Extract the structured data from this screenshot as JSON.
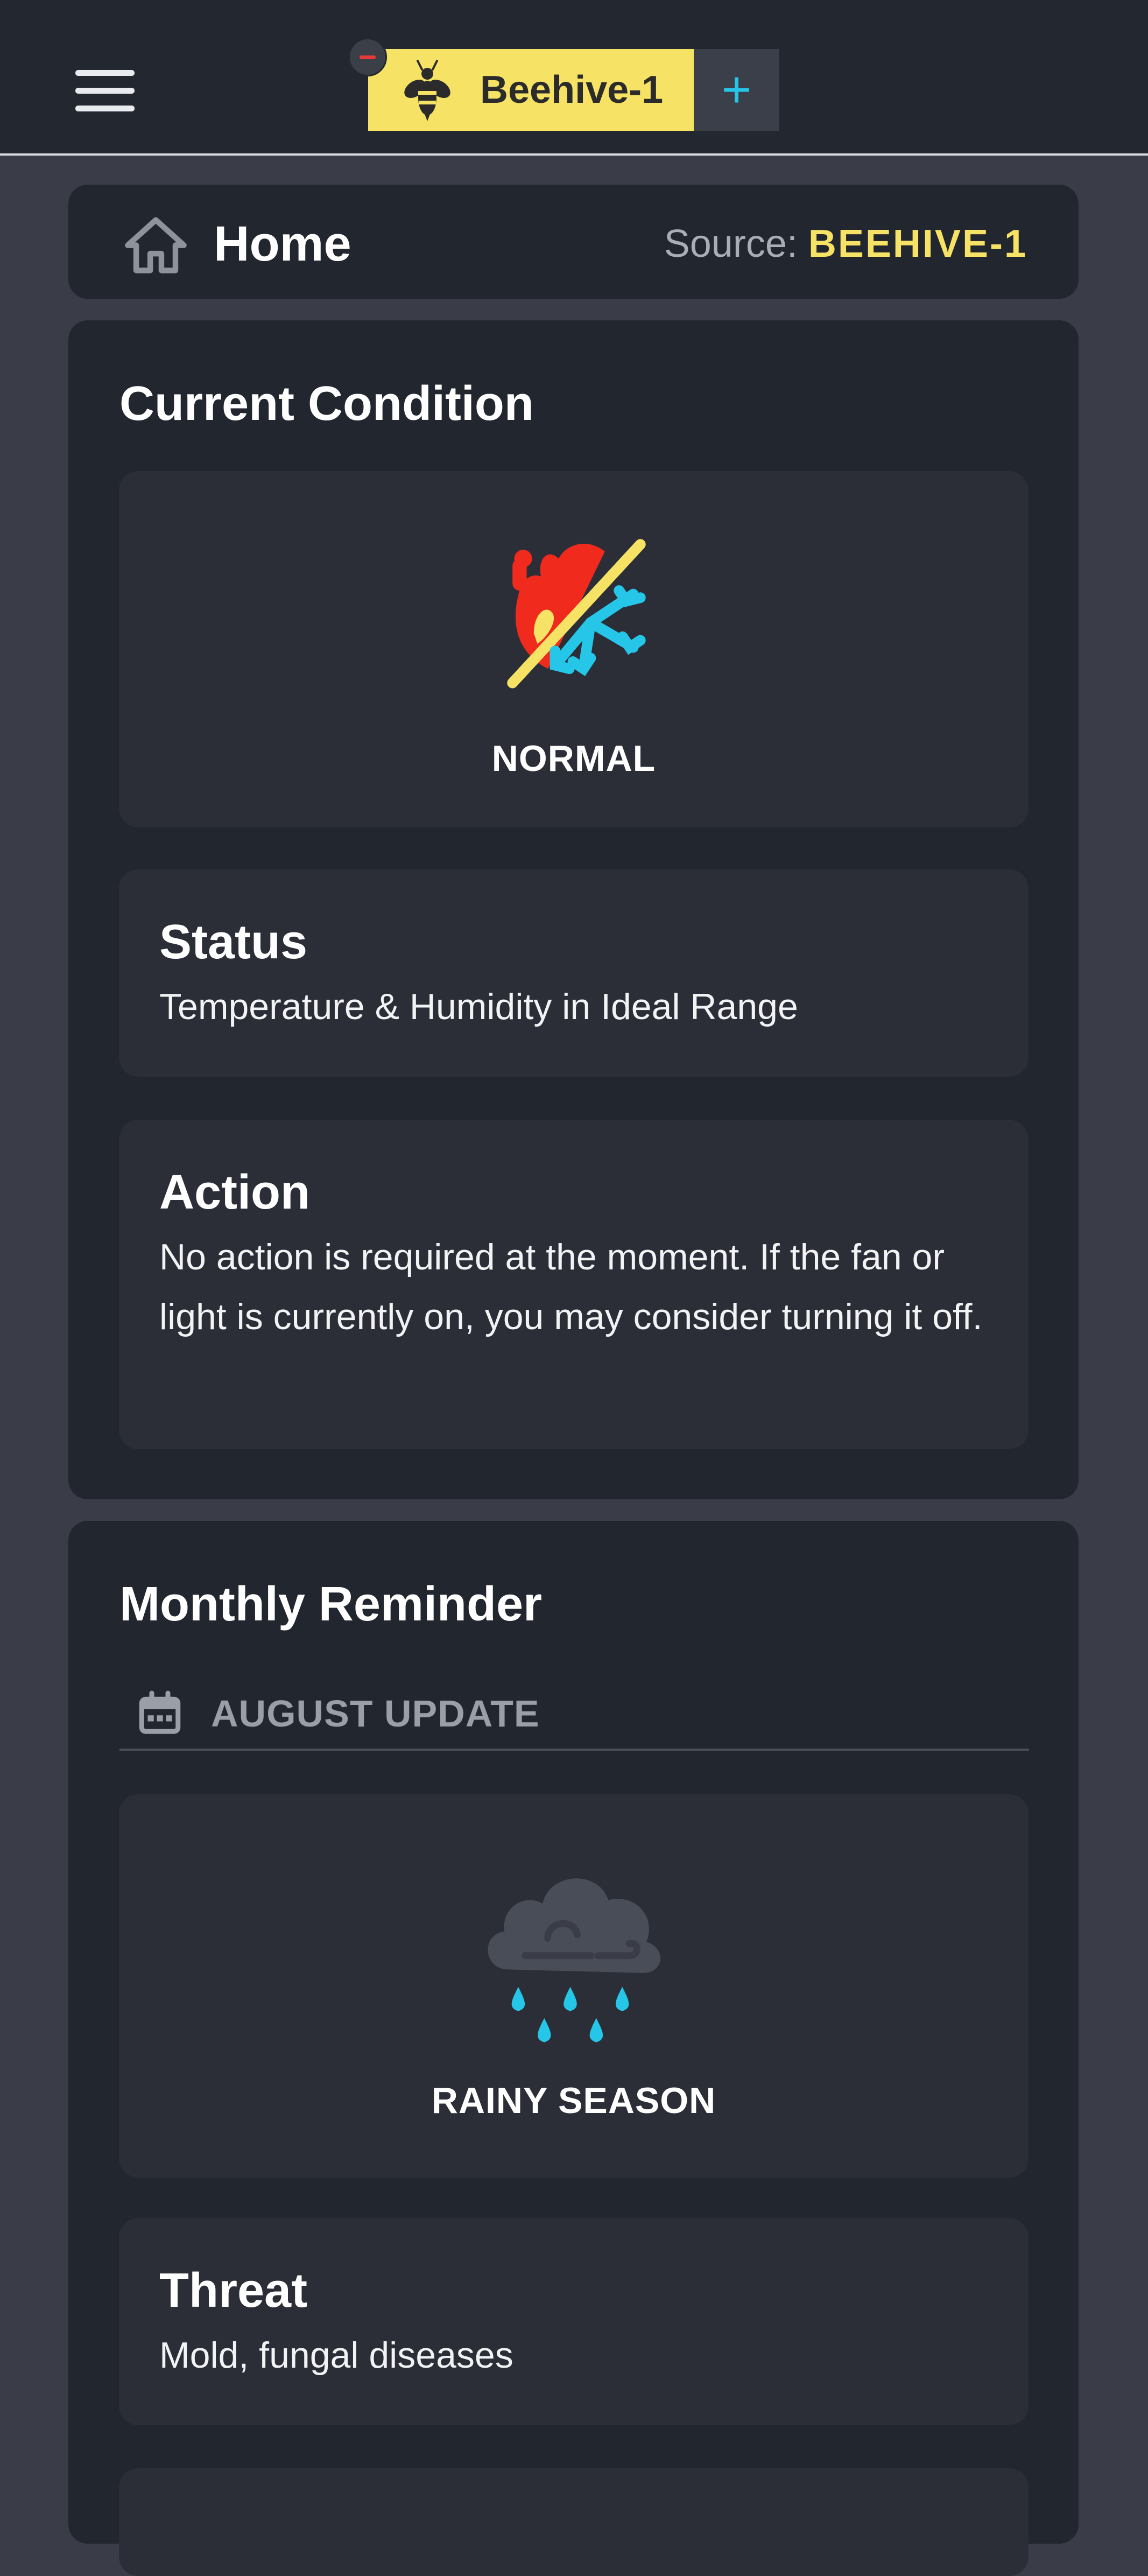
{
  "header": {
    "menu_icon": "hamburger-menu-icon",
    "active_tab": {
      "label": "Beehive-1",
      "icon": "bee-icon",
      "color": "#f6e264"
    },
    "remove_badge_icon": "minus-icon",
    "add_tab_label": "+"
  },
  "home_card": {
    "title": "Home",
    "icon": "home-icon",
    "source_label": "Source:",
    "source_value": "BEEHIVE-1"
  },
  "current_condition": {
    "title": "Current Condition",
    "condition_icon": "fire-snowflake-icon",
    "condition_label": "NORMAL",
    "status": {
      "heading": "Status",
      "text": "Temperature & Humidity in Ideal Range"
    },
    "action": {
      "heading": "Action",
      "text": "No action is required at the moment. If the fan or light is currently on, you may consider turning it off."
    }
  },
  "monthly_reminder": {
    "title": "Monthly Reminder",
    "update_icon": "calendar-icon",
    "update_label": "AUGUST UPDATE",
    "season_icon": "rain-cloud-icon",
    "season_label": "RAINY SEASON",
    "threat": {
      "heading": "Threat",
      "text": "Mold, fungal diseases"
    }
  },
  "colors": {
    "background": "#3a3d47",
    "card": "#22262e",
    "inner_card": "#2b2e37",
    "accent_yellow": "#f6e264",
    "accent_cyan": "#26c6e8",
    "fire_red": "#f02a1c"
  }
}
